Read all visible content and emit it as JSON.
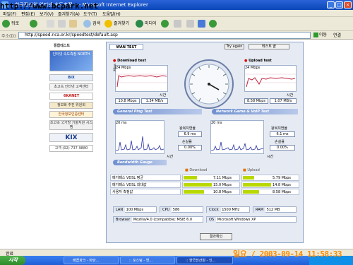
{
  "window": {
    "title": ":: 한국전산원 인터넷 속도측정 :: - Microsoft Internet Explorer"
  },
  "watermark": "http://www.bcpark.net",
  "menu": [
    "파일(F)",
    "편집(E)",
    "보기(V)",
    "즐겨찾기(A)",
    "도구(T)",
    "도움말(H)"
  ],
  "toolbar": {
    "back": "뒤로",
    "search": "검색",
    "favorites": "즐겨찾기",
    "media": "미디어"
  },
  "address": {
    "label": "주소(D)",
    "url": "http://speed.nca.or.kr/speedtest/default.asp",
    "go": "이동",
    "links": "연결"
  },
  "sidebar": {
    "title": "통합테스트",
    "items": [
      "인터넷 속도측정 NORTH",
      "BIX",
      "초고속 인터넷 고객센터",
      "6KANET",
      "정보화 추진 위원회",
      "한국정보인증센터",
      "초고속 국가망 기술지원 시스템",
      "KIX",
      "고객 (02) 737-9880"
    ]
  },
  "test": {
    "tab": "WAN TEST",
    "try_again": "Try again",
    "test_end": "테스트 끝",
    "download": {
      "title": "Download test",
      "mbps_label": "Mbps",
      "time_label": "시간",
      "mbps": "10.8 Mbps",
      "mbs": "1.34 MB/s",
      "axis_top": "24 Mbps"
    },
    "upload": {
      "title": "Upload test",
      "time_label": "시간",
      "mbps": "8.58 Mbps",
      "mbs": "1.07 MB/s",
      "axis_top": "24 Mbps"
    },
    "ping": {
      "title": "General Ping Test",
      "rtt_label": "왕복지연율",
      "rtt": "6.9 ms",
      "loss_label": "손실률",
      "loss": "0.00%",
      "time_label": "시간",
      "axis_top": "20 ms"
    },
    "voip": {
      "title": "Network Game & VoIP Test",
      "rtt_label": "왕복지연율",
      "rtt": "6.1 ms",
      "loss_label": "손실률",
      "loss": "0.00%",
      "time_label": "시간",
      "axis_top": "20 ms"
    },
    "gauge": {
      "title": "Bandwidth Gauge",
      "download_label": "Download",
      "upload_label": "Upload",
      "rows": [
        {
          "label": "메가패스 VDSL 평균",
          "down": "7.11 Mbps",
          "up": "5.79 Mbps",
          "down_frac": 0.47,
          "up_frac": 0.39
        },
        {
          "label": "메가패스 VDSL 최대값",
          "down": "15.0 Mbps",
          "up": "14.8 Mbps",
          "down_frac": 1.0,
          "up_frac": 0.99
        },
        {
          "label": "사용자 측정값",
          "down": "10.8 Mbps",
          "up": "8.58 Mbps",
          "down_frac": 0.72,
          "up_frac": 0.57
        }
      ]
    },
    "info": {
      "lan_label": "LAN",
      "lan": "100 Mbps",
      "cpu_label": "CPU",
      "cpu": "586",
      "clock_label": "Clock",
      "clock": "1500 MHz",
      "ram_label": "RAM",
      "ram": "512 MB",
      "browser_label": "Browser",
      "browser": "Mozilla/4.0 (compatible; MSIE 6.0",
      "os_label": "OS",
      "os": "Microsoft Windows XP"
    },
    "close": "결과확인"
  },
  "status": {
    "text": "완료"
  },
  "taskbar": {
    "start": "시작",
    "tasks": [
      "배꼽파크 - 마란...",
      ":: 포스팅 - 연...",
      ":: 한국전산원 - 인..."
    ]
  },
  "timestamp": "일요 / 2003-09-14 11:58:33",
  "colors": {
    "accent": "#0a47b8",
    "bar": "#b9d800",
    "line": "#c0203c",
    "ping": "#2a34a0"
  }
}
